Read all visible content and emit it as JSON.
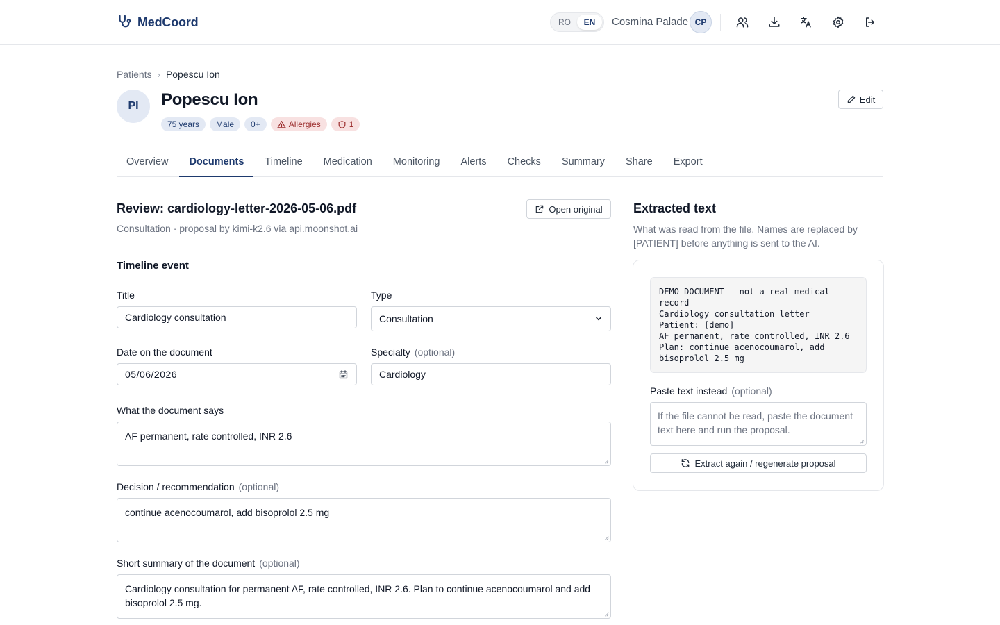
{
  "header": {
    "brand": "MedCoord",
    "languages": [
      "RO",
      "EN"
    ],
    "active_language": "EN",
    "user_name": "Cosmina Palade",
    "user_initials": "CP",
    "icons": [
      "users-icon",
      "download-icon",
      "translate-icon",
      "gear-icon",
      "logout-icon"
    ]
  },
  "breadcrumb": {
    "parent": "Patients",
    "separator": "›",
    "current": "Popescu Ion"
  },
  "patient": {
    "initials": "PI",
    "name": "Popescu Ion",
    "age": "75 years",
    "sex": "Male",
    "blood_type": "0+",
    "allergies_label": "Allergies",
    "alerts_count": "1",
    "edit_label": "Edit"
  },
  "tabs": [
    "Overview",
    "Documents",
    "Timeline",
    "Medication",
    "Monitoring",
    "Alerts",
    "Checks",
    "Summary",
    "Share",
    "Export"
  ],
  "active_tab": "Documents",
  "review": {
    "title": "Review: cardiology-letter-2026-05-06.pdf",
    "subtitle": "Consultation · proposal by kimi-k2.6 via api.moonshot.ai",
    "open_original_label": "Open original",
    "section_title": "Timeline event",
    "title_label": "Title",
    "title_value": "Cardiology consultation",
    "type_label": "Type",
    "type_value": "Consultation",
    "date_label": "Date on the document",
    "date_value": "05/06/2026",
    "specialty_label": "Specialty",
    "specialty_optional": "(optional)",
    "specialty_value": "Cardiology",
    "says_label": "What the document says",
    "says_value": "AF permanent, rate controlled, INR 2.6",
    "decision_label": "Decision / recommendation",
    "decision_optional": "(optional)",
    "decision_value": "continue acenocoumarol, add bisoprolol 2.5 mg",
    "summary_label": "Short summary of the document",
    "summary_optional": "(optional)",
    "summary_value": "Cardiology consultation for permanent AF, rate controlled, INR 2.6. Plan to continue acenocoumarol and add bisoprolol 2.5 mg."
  },
  "extracted": {
    "title": "Extracted text",
    "description": "What was read from the file. Names are replaced by [PATIENT] before anything is sent to the AI.",
    "text": "DEMO DOCUMENT - not a real medical record\nCardiology consultation letter\nPatient: [demo]\nAF permanent, rate controlled, INR 2.6\nPlan: continue acenocoumarol, add bisoprolol 2.5 mg",
    "paste_label": "Paste text instead",
    "paste_optional": "(optional)",
    "paste_placeholder": "If the file cannot be read, paste the document text here and run the proposal.",
    "regenerate_label": "Extract again / regenerate proposal"
  },
  "colors": {
    "brand": "#1e3a6e",
    "badge_bg": "#e3e9f4",
    "allergy_bg": "#f8e1e1",
    "allergy_text": "#9b2c2c"
  }
}
